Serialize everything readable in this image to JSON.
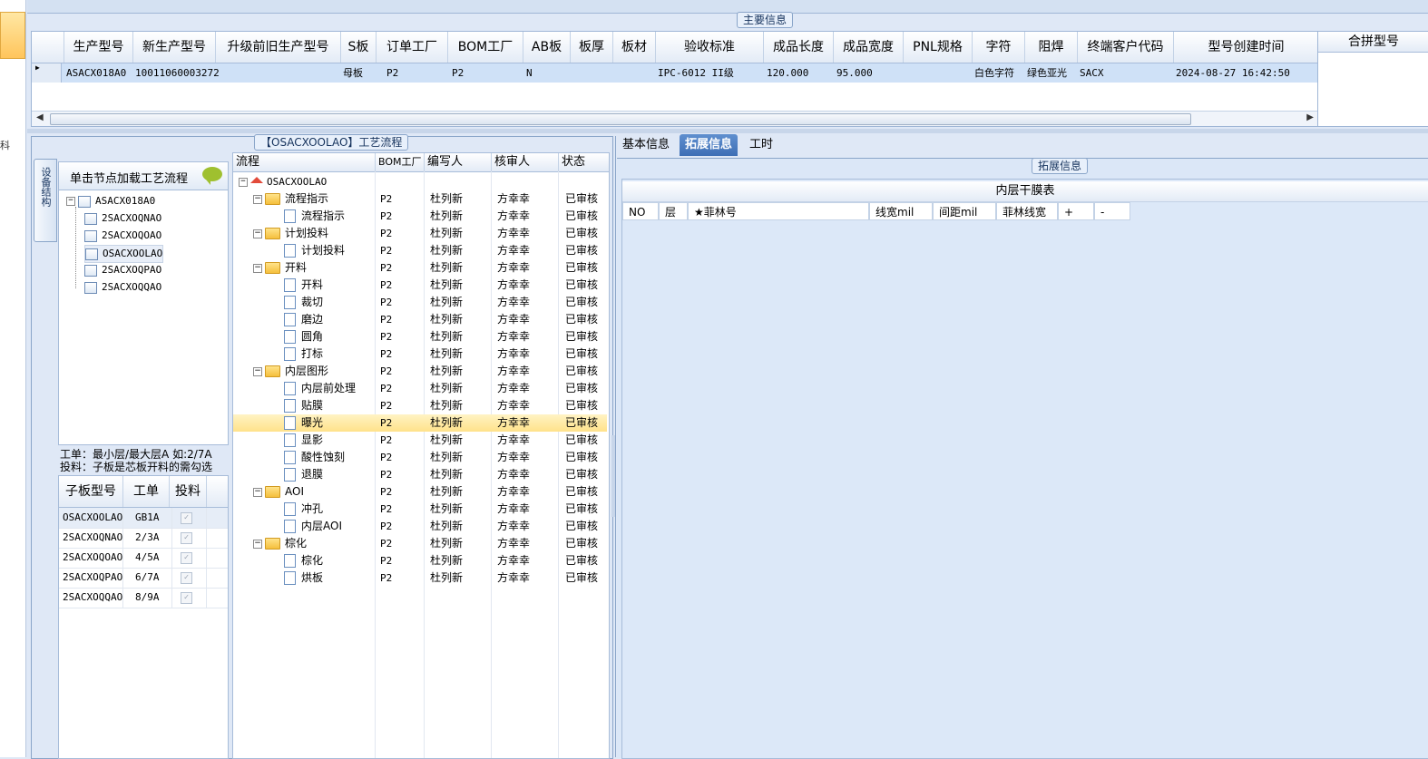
{
  "left_strip": {
    "glyph": "科"
  },
  "main_info": {
    "caption": "主要信息",
    "columns": [
      "生产型号",
      "新生产型号",
      "升级前旧生产型号",
      "S板",
      "订单工厂",
      "BOM工厂",
      "AB板",
      "板厚",
      "板材",
      "验收标准",
      "成品长度",
      "成品宽度",
      "PNL规格",
      "字符",
      "阻焊",
      "终端客户代码",
      "型号创建时间"
    ],
    "row": {
      "production_model": "ASACX018A0",
      "new_production_model": "10011060003272",
      "old_model": "",
      "s_board": "母板",
      "order_factory": "P2",
      "bom_factory": "P2",
      "ab_board": "N",
      "thickness": "",
      "material": "",
      "standard": "IPC-6012 II级",
      "length": "120.000",
      "width": "95.000",
      "pnl": "",
      "char": "白色字符",
      "solder": "绿色亚光",
      "customer": "SACX",
      "created": "2024-08-27 16:42:50"
    },
    "merge_header": "合拼型号"
  },
  "process": {
    "caption": "【OSACXOOLAO】工艺流程",
    "vertical_tab": "设备结构",
    "click_hint": "单击节点加载工艺流程",
    "tree_root": "ASACX018A0",
    "tree_children": [
      "2SACXOQNAO",
      "2SACXOQOAO",
      "OSACXOOLAO",
      "2SACXOQPAO",
      "2SACXOQQAO"
    ],
    "hint_line1": "工单：最小层/最大层A 如:2/7A",
    "hint_line2": "投料：子板是芯板开料的需勾选",
    "sub_columns": [
      "子板型号",
      "工单",
      "投料"
    ],
    "sub_rows": [
      {
        "model": "OSACXOOLAO",
        "order": "GB1A"
      },
      {
        "model": "2SACXOQNAO",
        "order": "2/3A"
      },
      {
        "model": "2SACXOQOAO",
        "order": "4/5A"
      },
      {
        "model": "2SACXOQPAO",
        "order": "6/7A"
      },
      {
        "model": "2SACXOQQAO",
        "order": "8/9A"
      }
    ],
    "flow_columns": [
      "流程",
      "BOM工厂",
      "编写人",
      "核审人",
      "状态"
    ],
    "flow_root": "OSACXOOLAO",
    "flow_rows": [
      {
        "name": "流程指示",
        "type": "folder"
      },
      {
        "name": "流程指示",
        "type": "doc"
      },
      {
        "name": "计划投料",
        "type": "folder"
      },
      {
        "name": "计划投料",
        "type": "doc"
      },
      {
        "name": "开料",
        "type": "folder"
      },
      {
        "name": "开料",
        "type": "doc"
      },
      {
        "name": "裁切",
        "type": "doc"
      },
      {
        "name": "磨边",
        "type": "doc"
      },
      {
        "name": "圆角",
        "type": "doc"
      },
      {
        "name": "打标",
        "type": "doc"
      },
      {
        "name": "内层图形",
        "type": "folder"
      },
      {
        "name": "内层前处理",
        "type": "doc"
      },
      {
        "name": "贴膜",
        "type": "doc"
      },
      {
        "name": "曝光",
        "type": "doc"
      },
      {
        "name": "显影",
        "type": "doc"
      },
      {
        "name": "酸性蚀刻",
        "type": "doc"
      },
      {
        "name": "退膜",
        "type": "doc"
      },
      {
        "name": "AOI",
        "type": "folder"
      },
      {
        "name": "冲孔",
        "type": "doc"
      },
      {
        "name": "内层AOI",
        "type": "doc"
      },
      {
        "name": "棕化",
        "type": "folder"
      },
      {
        "name": "棕化",
        "type": "doc"
      },
      {
        "name": "烘板",
        "type": "doc"
      }
    ],
    "bom_value": "P2",
    "writer": "杜列新",
    "reviewer": "方幸幸",
    "status": "已审核"
  },
  "right": {
    "tabs": [
      "基本信息",
      "拓展信息",
      "工时"
    ],
    "active_tab": "拓展信息",
    "caption": "拓展信息",
    "film_title": "内层干膜表",
    "film_columns": [
      "NO",
      "层",
      "★菲林号",
      "线宽mil",
      "间距mil",
      "菲林线宽",
      "+",
      "-"
    ]
  }
}
